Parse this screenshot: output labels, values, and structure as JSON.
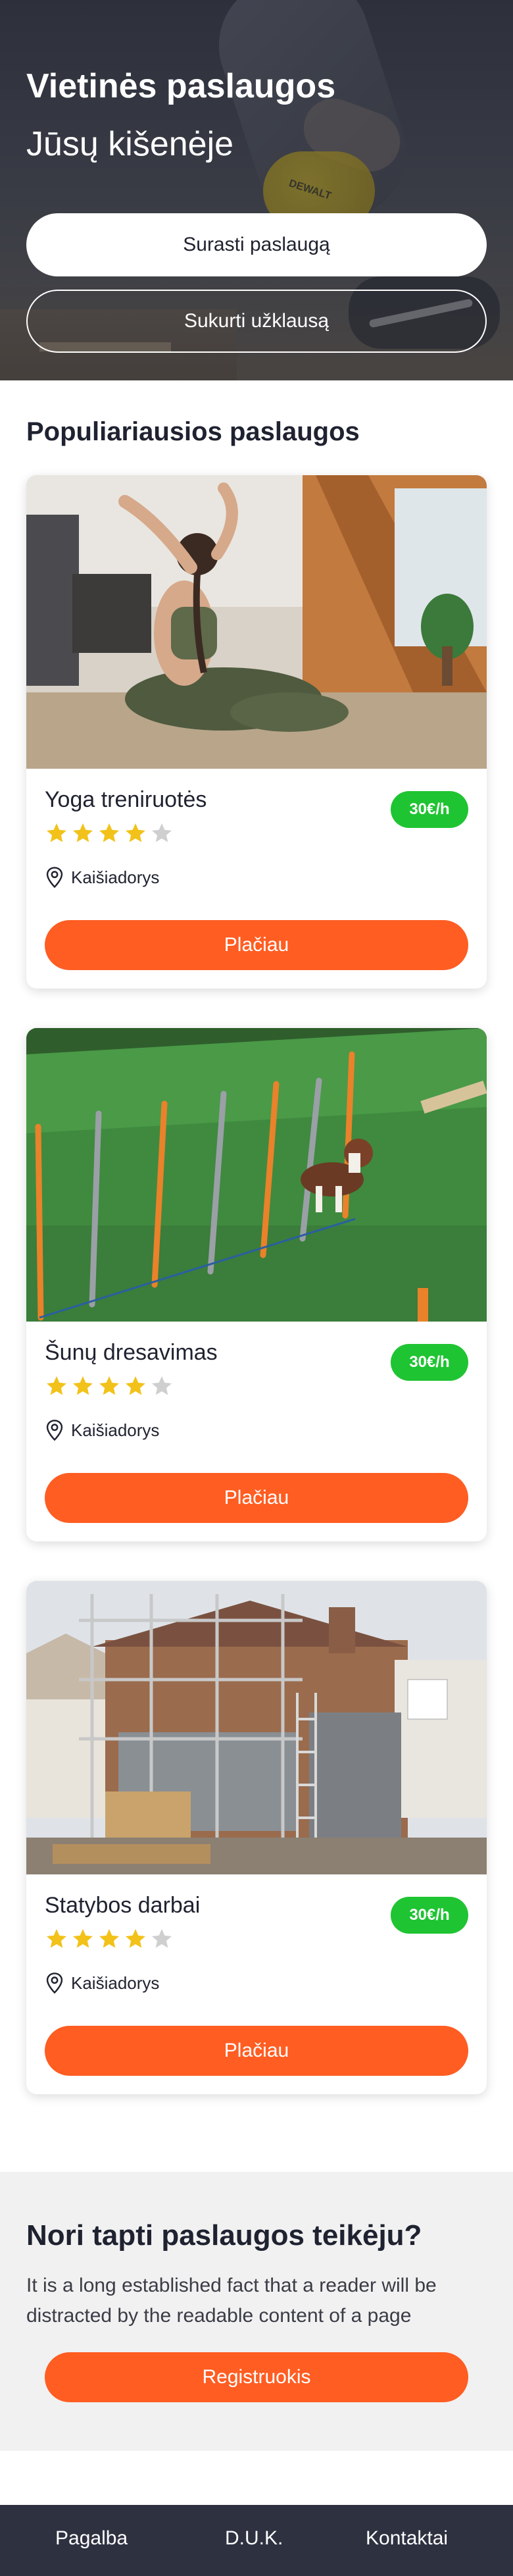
{
  "hero": {
    "title": "Vietinės paslaugos",
    "subtitle": "Jūsų kišenėje",
    "find_button": "Surasti paslaugą",
    "create_button": "Sukurti užklausą",
    "image_text": "DEWALT"
  },
  "popular": {
    "title": "Populiariausios paslaugos",
    "cards": [
      {
        "title": "Yoga treniruotės",
        "price": "30€/h",
        "rating": 4,
        "max_rating": 5,
        "location": "Kaišiadorys",
        "button": "Plačiau"
      },
      {
        "title": "Šunų dresavimas",
        "price": "30€/h",
        "rating": 4,
        "max_rating": 5,
        "location": "Kaišiadorys",
        "button": "Plačiau"
      },
      {
        "title": "Statybos darbai",
        "price": "30€/h",
        "rating": 4,
        "max_rating": 5,
        "location": "Kaišiadorys",
        "button": "Plačiau"
      }
    ]
  },
  "cta": {
    "title": "Nori tapti paslaugos teikėju?",
    "text": "It is a long established fact that a reader will be distracted by the readable content of a page",
    "button": "Registruokis"
  },
  "footer": {
    "links": [
      "Pagalba",
      "D.U.K.",
      "Kontaktai"
    ]
  },
  "colors": {
    "accent": "#ff5d22",
    "price_badge": "#1fc432",
    "star_filled": "#f2c21a",
    "star_empty": "#cfcfcf",
    "footer_bg": "#2e3140"
  }
}
